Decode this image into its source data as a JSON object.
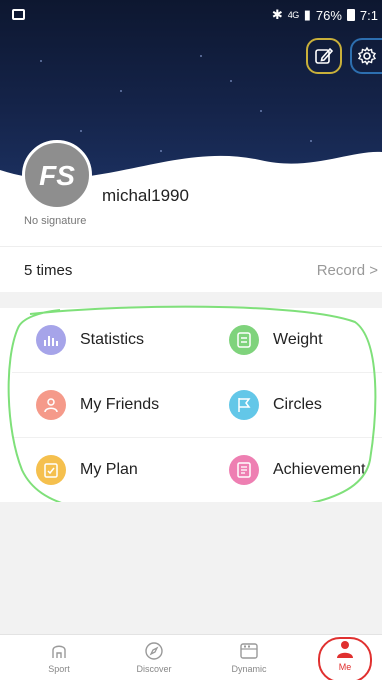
{
  "status_bar": {
    "network": "4G",
    "battery": "76%",
    "time": "7:1"
  },
  "profile": {
    "avatar_text": "FS",
    "username": "michal1990",
    "signature": "No signature"
  },
  "stats_row": {
    "count": "5 times",
    "record_label": "Record",
    "chevron": ">"
  },
  "menu": {
    "items": [
      {
        "label": "Statistics",
        "icon": "bar-chart-icon",
        "color": "#a6a4e9"
      },
      {
        "label": "Weight",
        "icon": "scale-icon",
        "color": "#7fd37c"
      },
      {
        "label": "My Friends",
        "icon": "friends-icon",
        "color": "#f59a8a"
      },
      {
        "label": "Circles",
        "icon": "flag-icon",
        "color": "#63c7e8"
      },
      {
        "label": "My Plan",
        "icon": "plan-icon",
        "color": "#f5c04e"
      },
      {
        "label": "Achievement",
        "icon": "achievement-icon",
        "color": "#ee7fb2"
      }
    ]
  },
  "tabbar": {
    "tabs": [
      {
        "label": "Sport",
        "icon": "shoe-icon"
      },
      {
        "label": "Discover",
        "icon": "compass-icon"
      },
      {
        "label": "Dynamic",
        "icon": "feed-icon"
      },
      {
        "label": "Me",
        "icon": "person-icon",
        "active": true
      }
    ]
  },
  "colors": {
    "accent": "#e0302f",
    "header_dark": "#0d1730",
    "annotation_green": "#7fe07a"
  }
}
